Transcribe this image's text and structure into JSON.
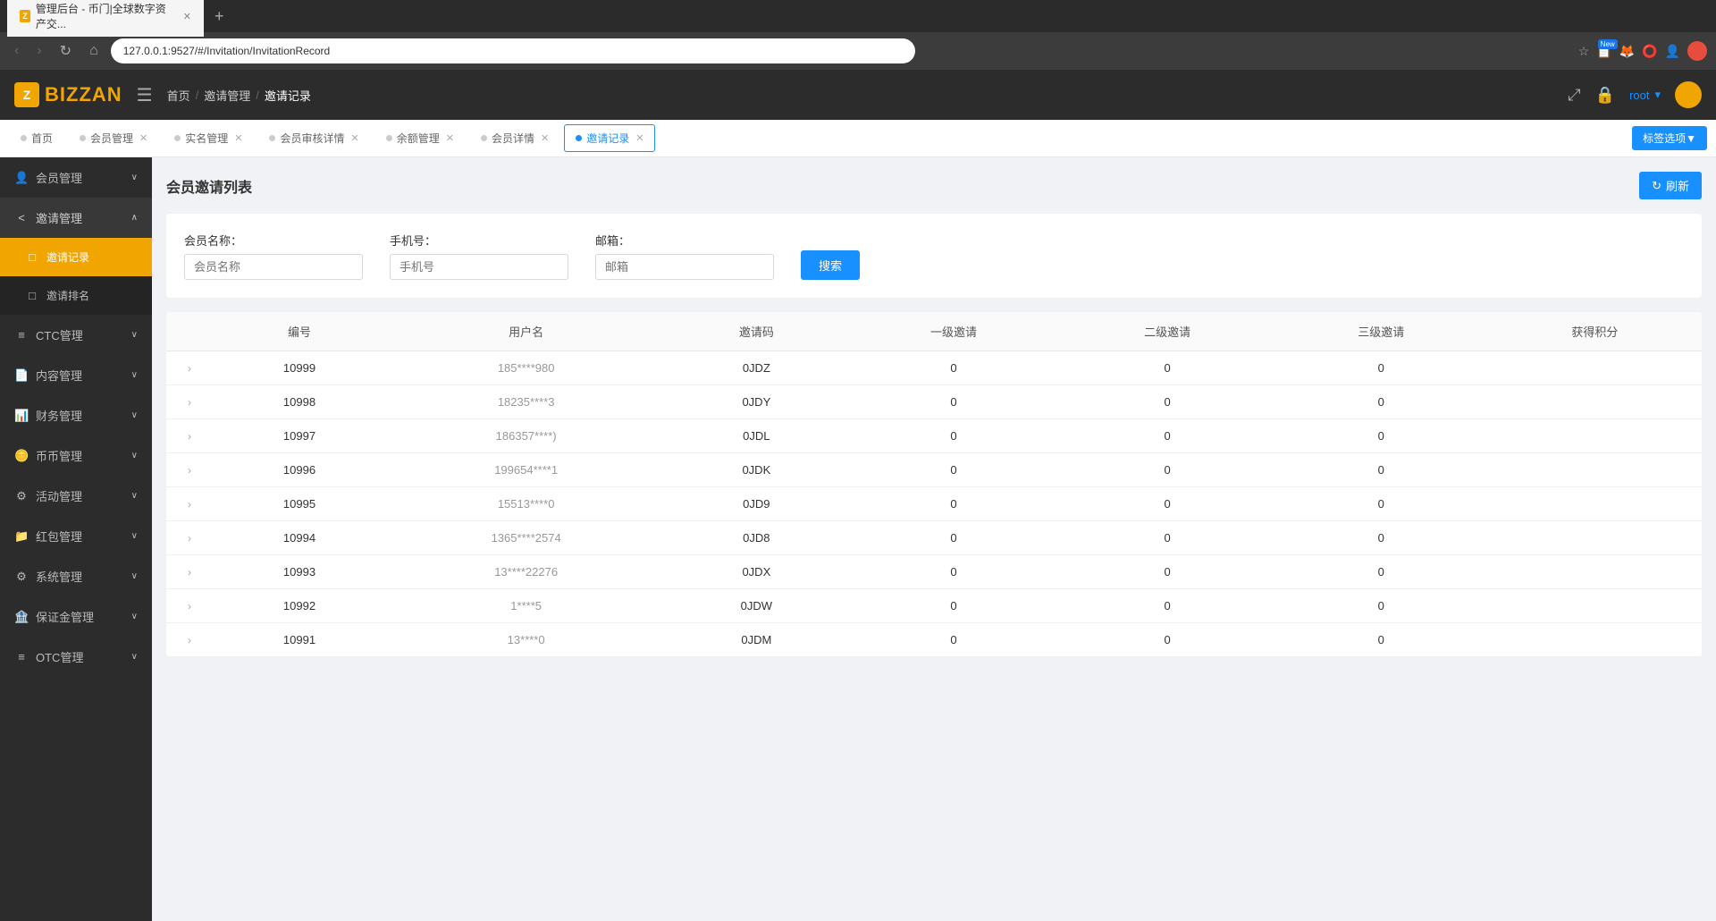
{
  "browser": {
    "tab_title": "管理后台 - 币门|全球数字资产交...",
    "url": "127.0.0.1:9527/#/Invitation/InvitationRecord",
    "new_badge": "New"
  },
  "header": {
    "logo_text": "BIZZAN",
    "breadcrumb": [
      "首页",
      "邀请管理",
      "邀请记录"
    ],
    "user": "root",
    "expand_icon": "⤢",
    "lock_icon": "🔒"
  },
  "tabs": [
    {
      "label": "首页",
      "closable": false,
      "active": false
    },
    {
      "label": "会员管理",
      "closable": true,
      "active": false
    },
    {
      "label": "实名管理",
      "closable": true,
      "active": false
    },
    {
      "label": "会员审核详情",
      "closable": true,
      "active": false
    },
    {
      "label": "余额管理",
      "closable": true,
      "active": false
    },
    {
      "label": "会员详情",
      "closable": true,
      "active": false
    },
    {
      "label": "邀请记录",
      "closable": true,
      "active": true
    }
  ],
  "tag_select_btn": "标签选项▼",
  "sidebar": {
    "items": [
      {
        "id": "member",
        "icon": "👤",
        "label": "会员管理",
        "expanded": false
      },
      {
        "id": "invitation",
        "icon": "<",
        "label": "邀请管理",
        "expanded": true,
        "active_parent": true
      },
      {
        "id": "invitation-record",
        "icon": "□",
        "label": "邀请记录",
        "active": true
      },
      {
        "id": "invitation-rank",
        "icon": "□",
        "label": "邀请排名"
      },
      {
        "id": "ctc",
        "icon": "≡",
        "label": "CTC管理",
        "expanded": false
      },
      {
        "id": "content",
        "icon": "📄",
        "label": "内容管理",
        "expanded": false
      },
      {
        "id": "finance",
        "icon": "📊",
        "label": "财务管理",
        "expanded": false
      },
      {
        "id": "coin",
        "icon": "🪙",
        "label": "币币管理",
        "expanded": false
      },
      {
        "id": "activity",
        "icon": "⚙",
        "label": "活动管理",
        "expanded": false
      },
      {
        "id": "redpack",
        "icon": "📁",
        "label": "红包管理",
        "expanded": false
      },
      {
        "id": "system",
        "icon": "⚙",
        "label": "系统管理",
        "expanded": false
      },
      {
        "id": "deposit",
        "icon": "🏦",
        "label": "保证金管理",
        "expanded": false
      },
      {
        "id": "otc",
        "icon": "≡",
        "label": "OTC管理",
        "expanded": false
      }
    ]
  },
  "page": {
    "title": "会员邀请列表",
    "refresh_btn": "刷新",
    "search": {
      "member_name_label": "会员名称：",
      "member_name_placeholder": "会员名称",
      "phone_label": "手机号：",
      "phone_placeholder": "手机号",
      "email_label": "邮箱：",
      "email_placeholder": "邮箱",
      "search_btn": "搜索"
    },
    "table": {
      "columns": [
        "编号",
        "用户名",
        "邀请码",
        "一级邀请",
        "二级邀请",
        "三级邀请",
        "获得积分"
      ],
      "rows": [
        {
          "id": "10999",
          "username": "185****980",
          "invite_code": "0JDZ",
          "level1": "0",
          "level2": "0",
          "level3": "0",
          "points": ""
        },
        {
          "id": "10998",
          "username": "18235****3",
          "invite_code": "0JDY",
          "level1": "0",
          "level2": "0",
          "level3": "0",
          "points": ""
        },
        {
          "id": "10997",
          "username": "186357****)",
          "invite_code": "0JDL",
          "level1": "0",
          "level2": "0",
          "level3": "0",
          "points": ""
        },
        {
          "id": "10996",
          "username": "199654****1",
          "invite_code": "0JDK",
          "level1": "0",
          "level2": "0",
          "level3": "0",
          "points": ""
        },
        {
          "id": "10995",
          "username": "15513****0",
          "invite_code": "0JD9",
          "level1": "0",
          "level2": "0",
          "level3": "0",
          "points": ""
        },
        {
          "id": "10994",
          "username": "1365****2574",
          "invite_code": "0JD8",
          "level1": "0",
          "level2": "0",
          "level3": "0",
          "points": ""
        },
        {
          "id": "10993",
          "username": "13****22276",
          "invite_code": "0JDX",
          "level1": "0",
          "level2": "0",
          "level3": "0",
          "points": ""
        },
        {
          "id": "10992",
          "username": "1****5",
          "invite_code": "0JDW",
          "level1": "0",
          "level2": "0",
          "level3": "0",
          "points": ""
        },
        {
          "id": "10991",
          "username": "13****0",
          "invite_code": "0JDM",
          "level1": "0",
          "level2": "0",
          "level3": "0",
          "points": ""
        }
      ]
    }
  }
}
